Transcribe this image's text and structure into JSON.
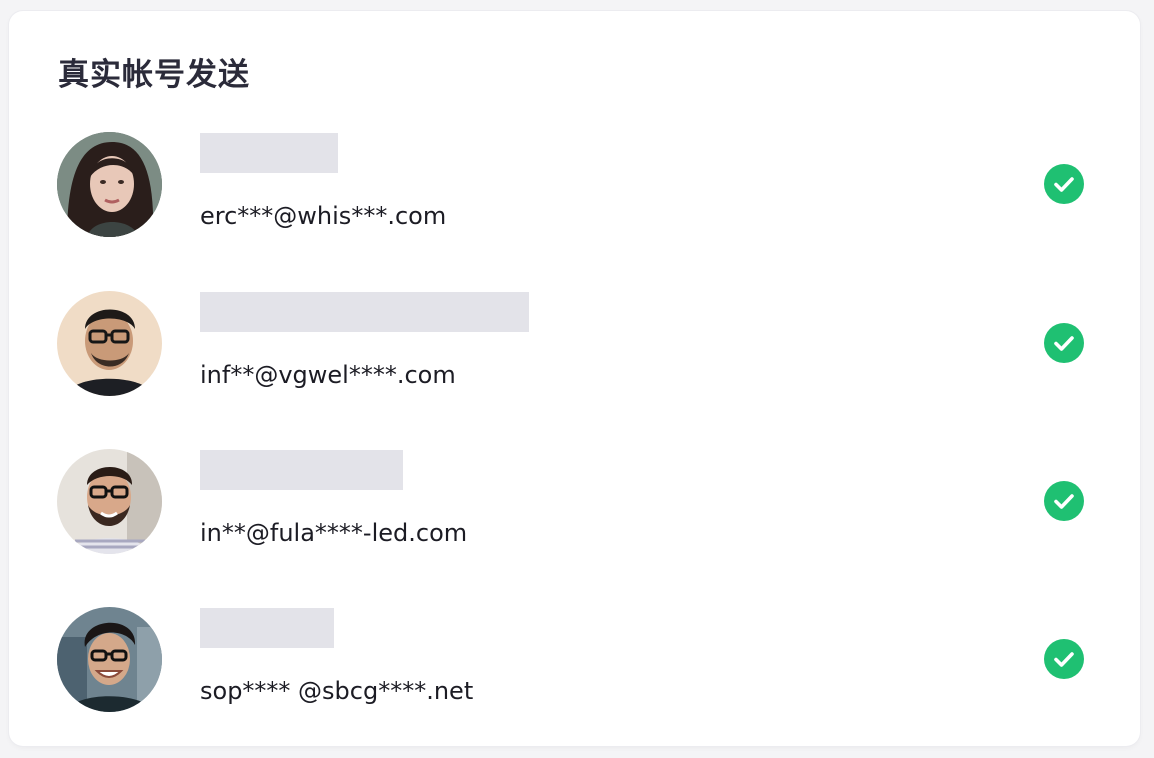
{
  "panel": {
    "title": "真实帐号发送"
  },
  "recipients": [
    {
      "email": "erc***@whis***.com",
      "name_redacted": true,
      "status": "sent",
      "avatar": "woman-portrait"
    },
    {
      "email": "inf**@vgwel****.com",
      "name_redacted": true,
      "status": "sent",
      "avatar": "man-glasses-portrait"
    },
    {
      "email": "in**@fula****-led.com",
      "name_redacted": true,
      "status": "sent",
      "avatar": "man-glasses-beard-portrait"
    },
    {
      "email": "sop**** @sbcg****.net",
      "name_redacted": true,
      "status": "sent",
      "avatar": "man-glasses-smiling-portrait"
    }
  ],
  "colors": {
    "check": "#1fc072",
    "redaction_bar": "#e3e3e9",
    "title": "#2b2b3a"
  },
  "icons": {
    "status": "check-circle-icon"
  }
}
